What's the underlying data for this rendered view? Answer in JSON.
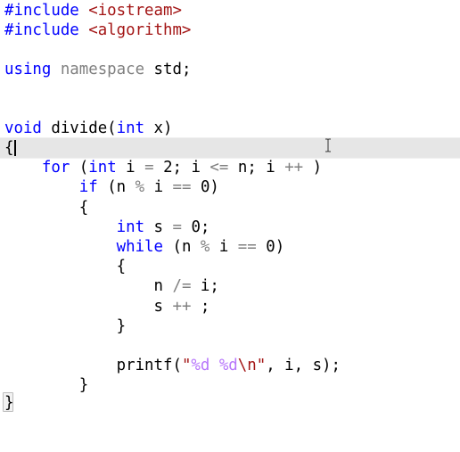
{
  "code": {
    "l1": {
      "t1": "#include ",
      "t2": "<iostream>"
    },
    "l2": {
      "t1": "#include ",
      "t2": "<algorithm>"
    },
    "l4": {
      "t1": "using ",
      "t2": "namespace",
      "t3": " std;"
    },
    "l7": {
      "t1": "void",
      "t2": " divide(",
      "t3": "int",
      "t4": " x)"
    },
    "l8": {
      "t1": "{"
    },
    "l9": {
      "t0": "    ",
      "t1": "for",
      "t2": " (",
      "t3": "int",
      "t4": " i ",
      "t5": "=",
      "t6": " 2; i ",
      "t7": "<=",
      "t8": " n; i ",
      "t9": "++",
      "t10": " )"
    },
    "l10": {
      "t0": "        ",
      "t1": "if",
      "t2": " (n ",
      "t3": "%",
      "t4": " i ",
      "t5": "==",
      "t6": " 0)"
    },
    "l11": {
      "t0": "        ",
      "t1": "{"
    },
    "l12": {
      "t0": "            ",
      "t1": "int",
      "t2": " s ",
      "t3": "=",
      "t4": " 0;"
    },
    "l13": {
      "t0": "            ",
      "t1": "while",
      "t2": " (n ",
      "t3": "%",
      "t4": " i ",
      "t5": "==",
      "t6": " 0)"
    },
    "l14": {
      "t0": "            ",
      "t1": "{"
    },
    "l15": {
      "t0": "                ",
      "t1": "n ",
      "t2": "/=",
      "t3": " i;"
    },
    "l16": {
      "t0": "                ",
      "t1": "s ",
      "t2": "++",
      "t3": " ;"
    },
    "l17": {
      "t0": "            ",
      "t1": "}"
    },
    "l19": {
      "t0": "            ",
      "t1": "printf(",
      "t2": "\"",
      "t3": "%d %d",
      "t4": "\\n",
      "t5": "\"",
      "t6": ", i, s);"
    },
    "l20": {
      "t0": "        ",
      "t1": "}"
    },
    "l21": {
      "t1": "}"
    }
  },
  "icons": {
    "cursor": "text-ibeam-icon"
  },
  "colors": {
    "keyword": "#0000ff",
    "string": "#a31515",
    "escape": "#b776fb",
    "operator": "#808080",
    "current_line": "#e6e6e6"
  }
}
